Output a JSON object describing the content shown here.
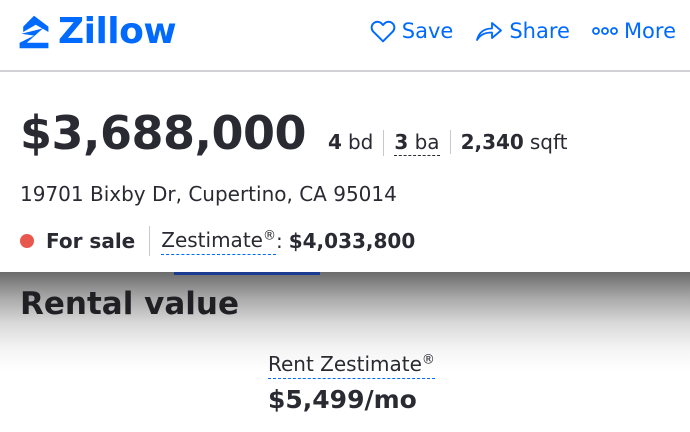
{
  "header": {
    "logo_text": "Zillow",
    "actions": {
      "save": "Save",
      "share": "Share",
      "more": "More"
    }
  },
  "listing": {
    "price": "$3,688,000",
    "beds_value": "4",
    "beds_unit": "bd",
    "baths_value": "3",
    "baths_unit": "ba",
    "sqft_value": "2,340",
    "sqft_unit": "sqft",
    "address": "19701 Bixby Dr, Cupertino, CA 95014",
    "status": "For sale",
    "zestimate_label": "Zestimate",
    "zestimate_mark": "®",
    "zestimate_colon": ":",
    "zestimate_value": "$4,033,800"
  },
  "rental": {
    "title": "Rental value",
    "rent_zestimate_label": "Rent Zestimate",
    "rent_zestimate_mark": "®",
    "rent_zestimate_value": "$5,499/mo"
  },
  "colors": {
    "brand": "#006aff",
    "status_for_sale": "#e8584e",
    "text": "#2a2a33"
  },
  "icons": [
    "zillow-logo-icon",
    "heart-icon",
    "share-icon",
    "more-icon"
  ]
}
